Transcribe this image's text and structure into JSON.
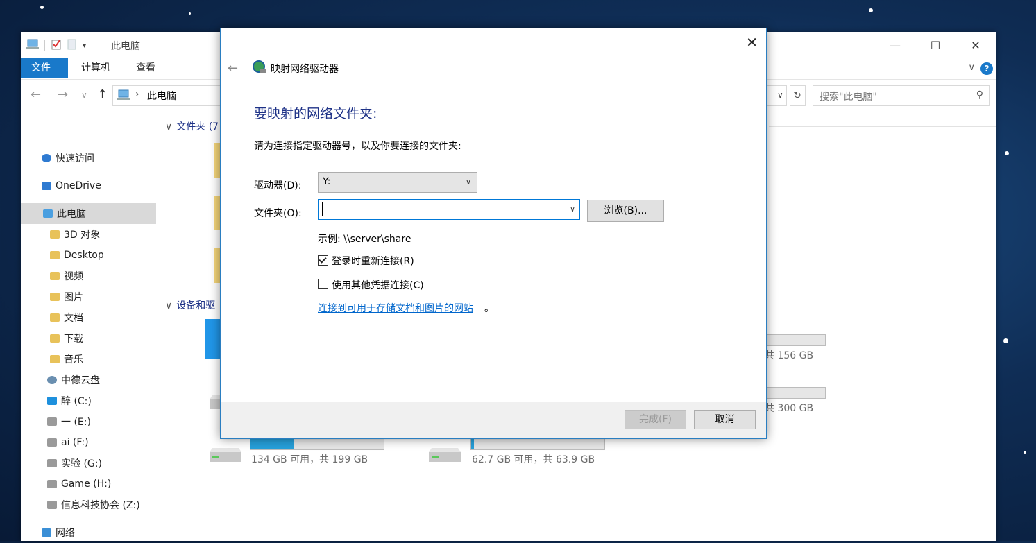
{
  "explorer": {
    "title": "此电脑",
    "ribbon_tabs": [
      "文件",
      "计算机",
      "查看"
    ],
    "address": "此电脑",
    "search_placeholder": "搜索\"此电脑\"",
    "nav_items": [
      {
        "label": "快速访问",
        "icon": "star-icon"
      },
      {
        "label": "OneDrive",
        "icon": "cloud-icon"
      },
      {
        "label": "此电脑",
        "icon": "pc-icon",
        "selected": true
      },
      {
        "label": "3D 对象",
        "icon": "folder-3d-icon"
      },
      {
        "label": "Desktop",
        "icon": "desktop-folder-icon"
      },
      {
        "label": "视频",
        "icon": "video-folder-icon"
      },
      {
        "label": "图片",
        "icon": "pictures-folder-icon"
      },
      {
        "label": "文档",
        "icon": "documents-folder-icon"
      },
      {
        "label": "下载",
        "icon": "downloads-folder-icon"
      },
      {
        "label": "音乐",
        "icon": "music-folder-icon"
      },
      {
        "label": "中德云盘",
        "icon": "cloud-disk-icon"
      },
      {
        "label": "醉  (C:)",
        "icon": "windows-drive-icon"
      },
      {
        "label": "一 (E:)",
        "icon": "drive-icon"
      },
      {
        "label": "ai (F:)",
        "icon": "drive-icon"
      },
      {
        "label": "实验 (G:)",
        "icon": "drive-icon"
      },
      {
        "label": "Game (H:)",
        "icon": "drive-icon"
      },
      {
        "label": "信息科技协会 (Z:)",
        "icon": "network-drive-icon"
      },
      {
        "label": "网络",
        "icon": "network-icon"
      }
    ],
    "groups": {
      "folders_header": "文件夹 (7",
      "devices_header": "设备和驱"
    },
    "drives": [
      {
        "text": "共 156 GB"
      },
      {
        "text": "共 300 GB"
      },
      {
        "text": "134 GB 可用，共 199 GB",
        "used_fraction": 0.33
      },
      {
        "text": "62.7 GB 可用，共 63.9 GB",
        "used_fraction": 0.02
      }
    ]
  },
  "dialog": {
    "title": "映射网络驱动器",
    "heading": "要映射的网络文件夹:",
    "instruction": "请为连接指定驱动器号，以及你要连接的文件夹:",
    "drive_label": "驱动器(D):",
    "drive_value": "Y:",
    "folder_label": "文件夹(O):",
    "folder_value": "",
    "browse_label": "浏览(B)...",
    "example": "示例: \\\\server\\share",
    "reconnect_label": "登录时重新连接(R)",
    "reconnect_checked": true,
    "other_creds_label": "使用其他凭据连接(C)",
    "other_creds_checked": false,
    "link_text": "连接到可用于存储文档和图片的网站",
    "link_suffix": "。",
    "finish_label": "完成(F)",
    "cancel_label": "取消"
  }
}
